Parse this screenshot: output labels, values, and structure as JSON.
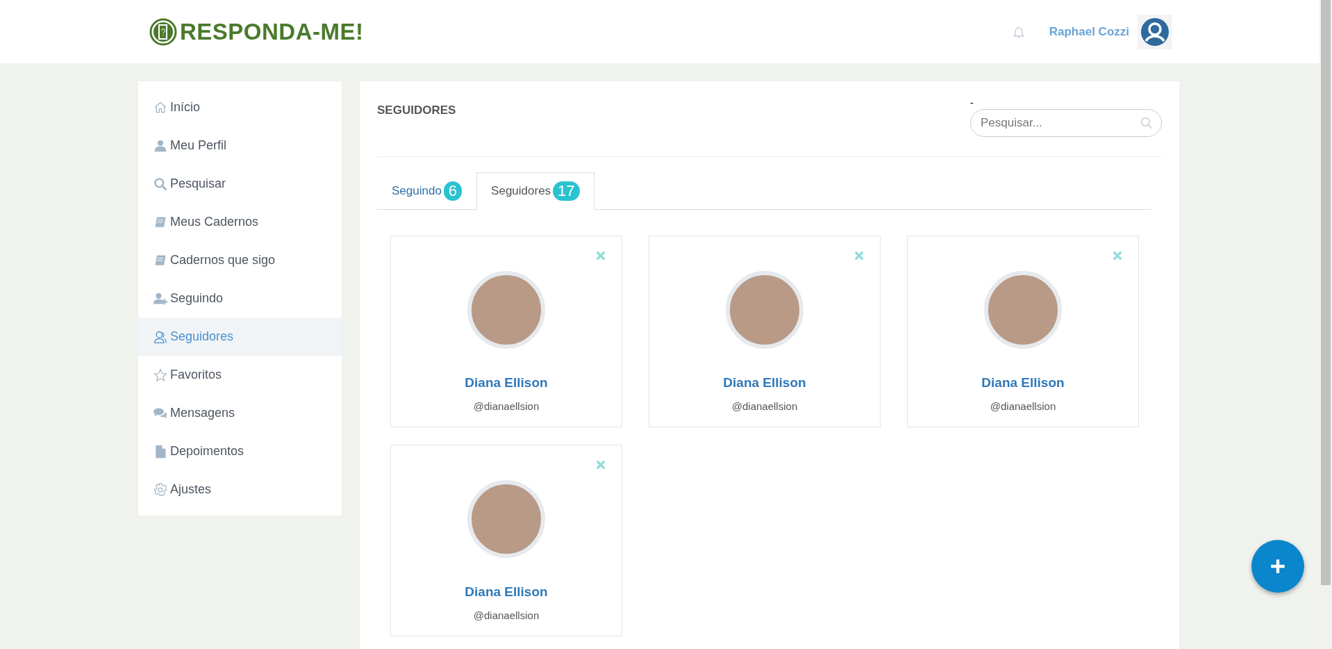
{
  "header": {
    "logo_text": "RESPONDA-ME!",
    "user_name": "Raphael Cozzi"
  },
  "sidebar": {
    "items": [
      {
        "label": "Início",
        "selected": false
      },
      {
        "label": "Meu Perfil",
        "selected": false
      },
      {
        "label": "Pesquisar",
        "selected": false
      },
      {
        "label": "Meus Cadernos",
        "selected": false
      },
      {
        "label": "Cadernos que sigo",
        "selected": false
      },
      {
        "label": "Seguindo",
        "selected": false
      },
      {
        "label": "Seguidores",
        "selected": true
      },
      {
        "label": "Favoritos",
        "selected": false
      },
      {
        "label": "Mensagens",
        "selected": false
      },
      {
        "label": "Depoimentos",
        "selected": false
      },
      {
        "label": "Ajustes",
        "selected": false
      }
    ]
  },
  "main": {
    "title": "SEGUIDORES",
    "dash": "-",
    "search": {
      "placeholder": "Pesquisar..."
    },
    "tabs": [
      {
        "label": "Seguindo",
        "count": "6",
        "selected": false
      },
      {
        "label": "Seguidores",
        "count": "17",
        "selected": true
      }
    ],
    "cards": [
      {
        "name": "Diana Ellison",
        "handle": "@dianaellsion"
      },
      {
        "name": "Diana Ellison",
        "handle": "@dianaellsion"
      },
      {
        "name": "Diana Ellison",
        "handle": "@dianaellsion"
      },
      {
        "name": "Diana Ellison",
        "handle": "@dianaellsion"
      }
    ]
  }
}
